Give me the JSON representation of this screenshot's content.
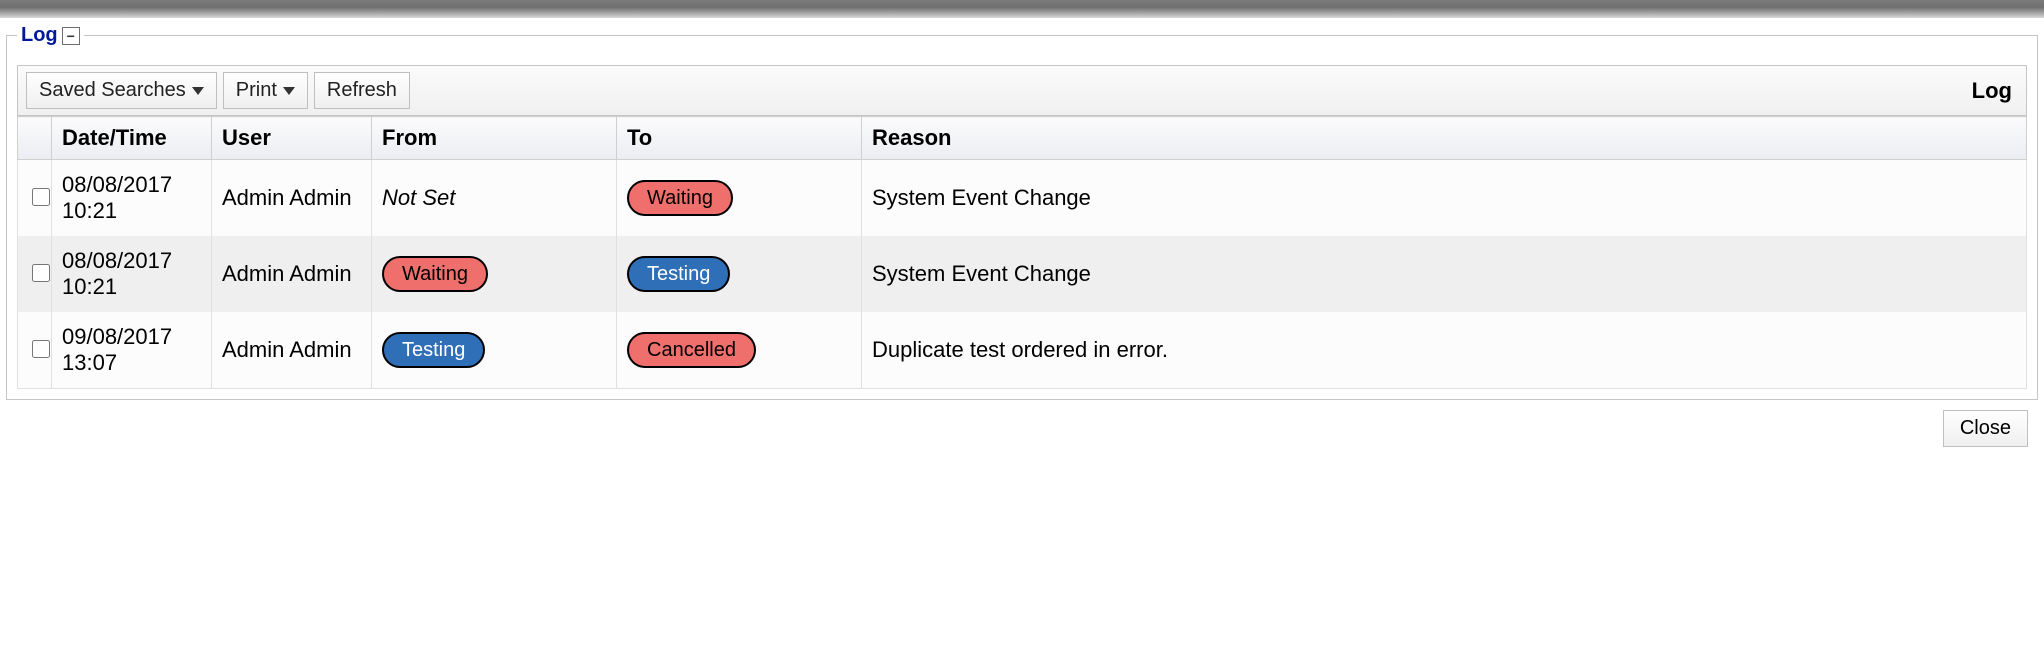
{
  "legend": {
    "title": "Log"
  },
  "toolbar": {
    "saved_searches_label": "Saved Searches",
    "print_label": "Print",
    "refresh_label": "Refresh",
    "right_label": "Log"
  },
  "columns": {
    "checkbox": "",
    "datetime": "Date/Time",
    "user": "User",
    "from": "From",
    "to": "To",
    "reason": "Reason"
  },
  "status_styles": {
    "Waiting": "red",
    "Testing": "blue",
    "Cancelled": "red"
  },
  "rows": [
    {
      "datetime": "08/08/2017 10:21",
      "user": "Admin Admin",
      "from": {
        "type": "text",
        "value": "Not Set",
        "italic": true
      },
      "to": {
        "type": "pill",
        "value": "Waiting"
      },
      "reason": "System Event Change"
    },
    {
      "datetime": "08/08/2017 10:21",
      "user": "Admin Admin",
      "from": {
        "type": "pill",
        "value": "Waiting"
      },
      "to": {
        "type": "pill",
        "value": "Testing"
      },
      "reason": "System Event Change"
    },
    {
      "datetime": "09/08/2017 13:07",
      "user": "Admin Admin",
      "from": {
        "type": "pill",
        "value": "Testing"
      },
      "to": {
        "type": "pill",
        "value": "Cancelled"
      },
      "reason": "Duplicate test ordered in error."
    }
  ],
  "footer": {
    "close_label": "Close"
  }
}
